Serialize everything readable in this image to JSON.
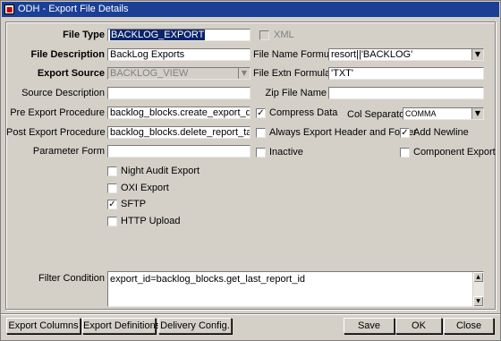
{
  "window": {
    "title": "ODH - Export File Details",
    "icon": "app-icon"
  },
  "left": {
    "file_type": {
      "label": "File Type",
      "value": "BACKLOG_EXPORT"
    },
    "file_description": {
      "label": "File Description",
      "value": "BackLog Exports"
    },
    "export_source": {
      "label": "Export Source",
      "value": "BACKLOG_VIEW"
    },
    "source_description": {
      "label": "Source Description",
      "value": ""
    },
    "pre_export": {
      "label": "Pre Export Procedure",
      "value": "backlog_blocks.create_export_data(pr"
    },
    "post_export": {
      "label": "Post Export Procedure",
      "value": "backlog_blocks.delete_report_table"
    },
    "parameter_form": {
      "label": "Parameter Form",
      "value": ""
    }
  },
  "right": {
    "xml": {
      "label": "XML",
      "checked": false,
      "disabled": true
    },
    "file_name_formula": {
      "label": "File Name Formula",
      "value": "resort||'BACKLOG'"
    },
    "file_extn_formula": {
      "label": "File Extn Formula",
      "value": "'TXT'"
    },
    "zip_file_name": {
      "label": "Zip File Name",
      "value": ""
    },
    "compress_data": {
      "label": "Compress Data",
      "checked": true
    },
    "col_separator": {
      "label": "Col Separator",
      "value": "COMMA"
    },
    "always_export_header": {
      "label": "Always Export Header and Footer",
      "checked": false
    },
    "add_newline": {
      "label": "Add Newline",
      "checked": true
    },
    "inactive": {
      "label": "Inactive",
      "checked": false
    },
    "component_export": {
      "label": "Component Export",
      "checked": false
    }
  },
  "options": [
    {
      "label": "Night Audit Export",
      "checked": false
    },
    {
      "label": "OXI Export",
      "checked": false
    },
    {
      "label": "SFTP",
      "checked": true
    },
    {
      "label": "HTTP Upload",
      "checked": false
    }
  ],
  "filter": {
    "label": "Filter Condition",
    "value": "export_id=backlog_blocks.get_last_report_id"
  },
  "buttons": {
    "export_columns": "Export Columns",
    "export_definitions": "Export Definitions",
    "delivery_config": "Delivery Config.",
    "save": "Save",
    "ok": "OK",
    "close": "Close"
  },
  "glyphs": {
    "dropdown": "▼",
    "check": "✓",
    "up": "▲",
    "down": "▼"
  }
}
